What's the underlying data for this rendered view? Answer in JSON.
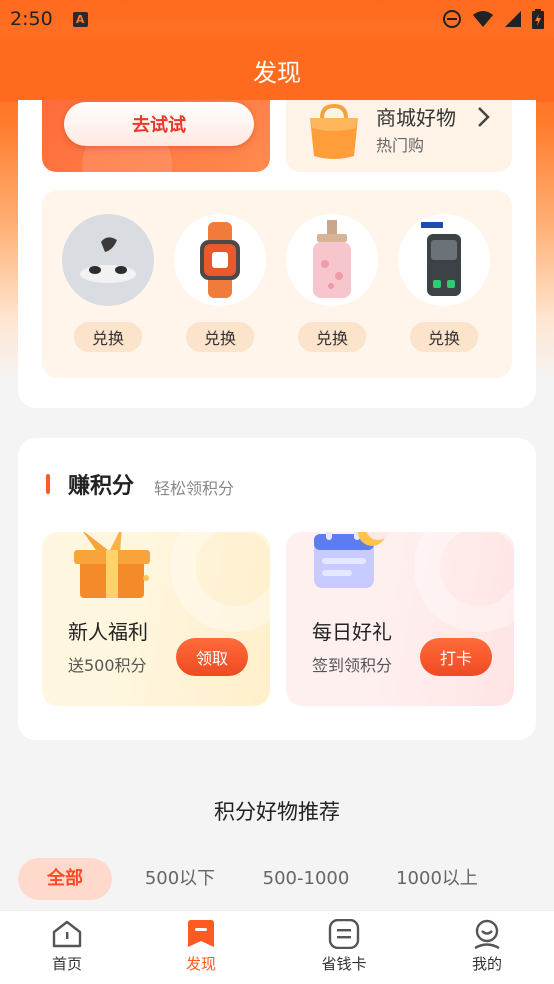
{
  "status_bar": {
    "time": "2:50",
    "badge": "A"
  },
  "header": {
    "title": "发现"
  },
  "top_card": {
    "try_button": "去试试",
    "mall": {
      "title": "商城好物",
      "subtitle": "热门购"
    },
    "products": [
      {
        "name": "earbuds",
        "button": "兑换"
      },
      {
        "name": "smartwatch",
        "button": "兑换"
      },
      {
        "name": "body-wash",
        "button": "兑换"
      },
      {
        "name": "gaming-earbuds",
        "button": "兑换"
      }
    ]
  },
  "earn": {
    "title": "赚积分",
    "subtitle": "轻松领积分",
    "tasks": [
      {
        "title": "新人福利",
        "subtitle": "送500积分",
        "button": "领取"
      },
      {
        "title": "每日好礼",
        "subtitle": "签到领积分",
        "button": "打卡"
      }
    ]
  },
  "recommend": {
    "title": "积分好物推荐",
    "filters": [
      "全部",
      "500以下",
      "500-1000",
      "1000以上"
    ],
    "active_filter": "全部"
  },
  "bottom_nav": {
    "items": [
      {
        "label": "首页",
        "icon": "home-icon"
      },
      {
        "label": "发现",
        "icon": "discover-icon"
      },
      {
        "label": "省钱卡",
        "icon": "card-icon"
      },
      {
        "label": "我的",
        "icon": "profile-icon"
      }
    ],
    "active": "发现"
  },
  "colors": {
    "accent": "#ff5a22",
    "header": "#ff6b1e"
  }
}
